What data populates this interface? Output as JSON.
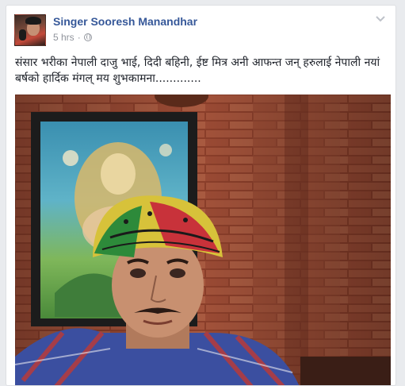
{
  "post": {
    "author_name": "Singer Sooresh Manandhar",
    "timestamp": "5 hrs",
    "separator": "·",
    "privacy_icon": "globe-icon",
    "menu_icon": "chevron-down-icon",
    "text": "संसार भरीका नेपाली दाजु भाई, दिदी बहिनी, ईष्ट मित्र अनी आफन्त जन् हरुलाई नेपाली नयां बर्षको हार्दिक मंगल् मय शुभकामना.............",
    "photo_subject": "man-in-turban-selfie"
  },
  "colors": {
    "link": "#365899",
    "meta": "#90949c",
    "text": "#1d2129",
    "background": "#e9ebee"
  }
}
